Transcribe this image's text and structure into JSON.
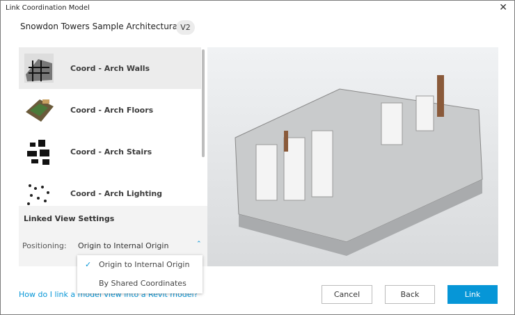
{
  "window": {
    "title": "Link Coordination Model"
  },
  "file": {
    "name": "Snowdon Towers Sample Architectural.rvt",
    "version": "V2"
  },
  "views": [
    {
      "label": "Coord - Arch Walls",
      "selected": true
    },
    {
      "label": "Coord - Arch Floors"
    },
    {
      "label": "Coord - Arch Stairs"
    },
    {
      "label": "Coord - Arch Lighting"
    }
  ],
  "settings": {
    "title": "Linked View Settings",
    "positioning_label": "Positioning:",
    "positioning_value": "Origin to Internal Origin"
  },
  "dropdown": {
    "options": [
      "Origin to Internal Origin",
      "By Shared Coordinates"
    ],
    "selected": 0
  },
  "help_link": "How do I link a model view into a Revit model?",
  "buttons": {
    "cancel": "Cancel",
    "back": "Back",
    "link": "Link"
  },
  "colors": {
    "accent": "#0696d7"
  }
}
